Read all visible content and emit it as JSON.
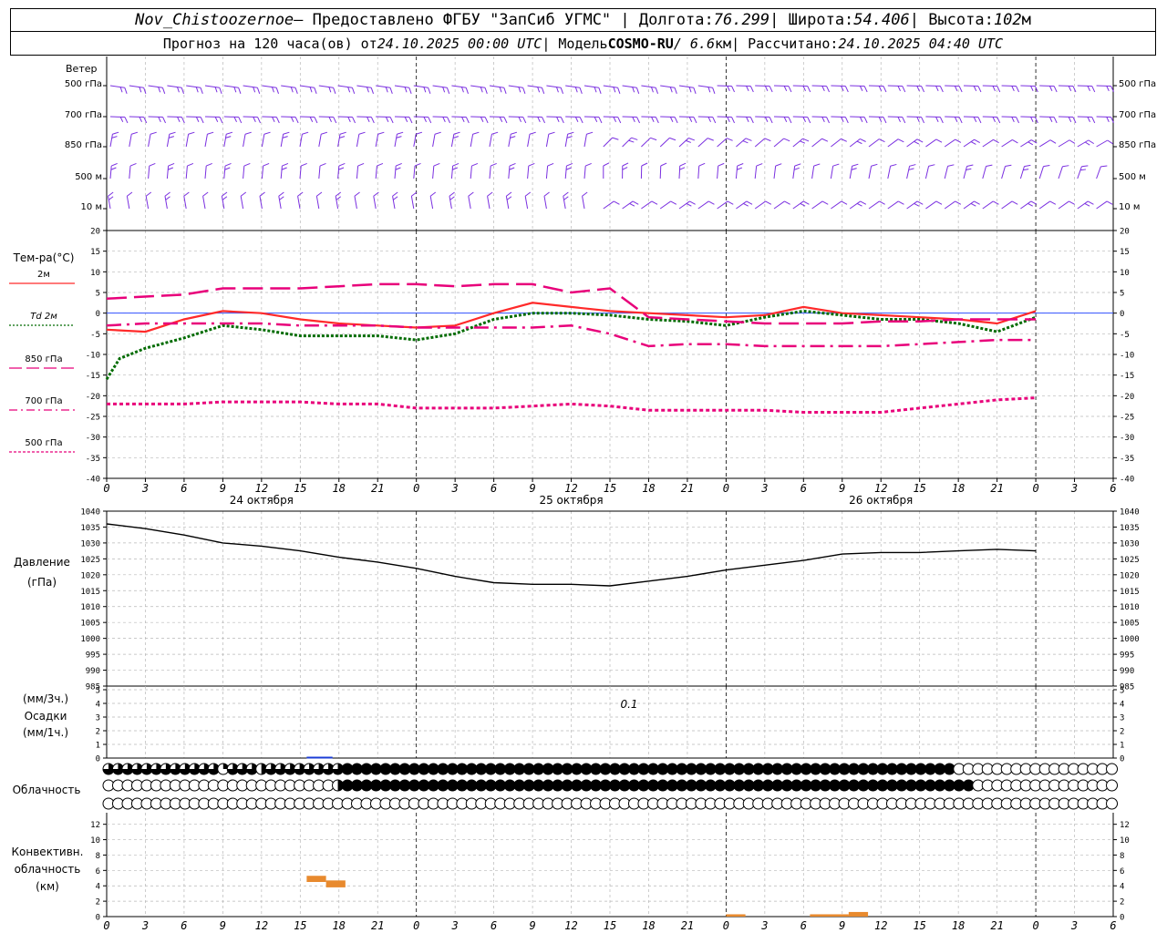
{
  "header": {
    "station": "Nov_Chistoozernoe",
    "provided_by": " – Предоставлено ФГБУ \"ЗапСиб УГМС\" | Долгота: ",
    "longitude": "76.299",
    "lat_label": " | Широта: ",
    "latitude": "54.406",
    "alt_label": " | Высота: ",
    "altitude": "102",
    "alt_unit": "м",
    "forecast_prefix": "Прогноз на 120 часа(ов) от ",
    "forecast_start": "24.10.2025 00:00 UTC",
    "model_label": "  | Модель ",
    "model": "COSMO-RU",
    "resolution": " / 6.6",
    "res_unit": "км",
    "computed_label": " | Рассчитано: ",
    "computed": "24.10.2025 04:40 UTC"
  },
  "wind_panel": {
    "title": "Ветер",
    "levels": [
      "500 гПа",
      "700 гПа",
      "850 гПа",
      "500 м",
      "10  м"
    ]
  },
  "temp_panel": {
    "title": "Тем-ра(°C)",
    "legend": [
      {
        "label": "2м",
        "color": "#ff2a2a",
        "style": "solid"
      },
      {
        "label": "Td  2м",
        "color": "#006b00",
        "style": "dotted"
      },
      {
        "label": "850 гПа",
        "color": "#e8007a",
        "style": "long-dash"
      },
      {
        "label": "700 гПа",
        "color": "#e8007a",
        "style": "dash-dot"
      },
      {
        "label": "500 гПа",
        "color": "#e8007a",
        "style": "short-dash"
      }
    ]
  },
  "pressure_panel": {
    "title": "Давление",
    "unit": "(гПа)"
  },
  "precip_panel": {
    "unit_top": "(мм/3ч.)",
    "title": "Осадки",
    "unit_bottom": "(мм/1ч.)",
    "annotation": "0.1"
  },
  "cloud_panel": {
    "title": "Облачность"
  },
  "conv_panel": {
    "title_1": "Конвективн.",
    "title_2": "облачность",
    "unit": "(км)"
  },
  "x_axis": {
    "hour_ticks": [
      "0",
      "3",
      "6",
      "9",
      "12",
      "15",
      "18",
      "21",
      "0",
      "3",
      "6",
      "9",
      "12",
      "15",
      "18",
      "21",
      "0",
      "3",
      "6",
      "9",
      "12",
      "15",
      "18",
      "21",
      "0",
      "3",
      "6"
    ],
    "days": [
      "24 октября",
      "25 октября",
      "26 октября"
    ]
  },
  "chart_data": [
    {
      "type": "line",
      "panel": "temperature",
      "x_unit": "hours since 24.10.2025 00 UTC",
      "ylim": [
        -40,
        20
      ],
      "yticks": [
        "20",
        "15",
        "10",
        "5",
        "0",
        "-5",
        "-10",
        "-15",
        "-20",
        "-25",
        "-30",
        "-35",
        "-40"
      ],
      "series": [
        {
          "name": "2м",
          "color": "#ff2a2a",
          "x": [
            0,
            3,
            6,
            9,
            12,
            15,
            18,
            21,
            24,
            27,
            30,
            33,
            36,
            39,
            42,
            45,
            48,
            51,
            54,
            57,
            60,
            63,
            66,
            69,
            72
          ],
          "y": [
            -4,
            -4.5,
            -1.5,
            0.5,
            0,
            -1.5,
            -2.5,
            -3,
            -3.5,
            -3,
            0,
            2.5,
            1.5,
            0.5,
            0,
            -0.5,
            -1,
            -0.5,
            1.5,
            0,
            -0.5,
            -1,
            -1.5,
            -2.5,
            0.5
          ]
        },
        {
          "name": "Td  2м",
          "color": "#006b00",
          "x": [
            0,
            1,
            3,
            6,
            9,
            12,
            15,
            18,
            21,
            24,
            27,
            30,
            33,
            36,
            39,
            42,
            45,
            48,
            51,
            54,
            57,
            60,
            63,
            66,
            69,
            72
          ],
          "y": [
            -16,
            -11,
            -8.5,
            -6,
            -3,
            -4,
            -5.5,
            -5.5,
            -5.5,
            -6.5,
            -5,
            -1.5,
            0,
            0,
            -0.5,
            -1.5,
            -2,
            -3,
            -1,
            0.5,
            -0.5,
            -1.5,
            -1.5,
            -2.5,
            -4.5,
            -1
          ]
        },
        {
          "name": "850 гПа",
          "color": "#e8007a",
          "x": [
            0,
            3,
            6,
            9,
            12,
            15,
            18,
            21,
            24,
            27,
            30,
            33,
            36,
            39,
            42,
            45,
            48,
            51,
            54,
            57,
            60,
            63,
            66,
            69,
            72
          ],
          "y": [
            3.5,
            4,
            4.5,
            6,
            6,
            6,
            6.5,
            7,
            7,
            6.5,
            7,
            7,
            5,
            6,
            -1,
            -1.5,
            -2,
            -2.5,
            -2.5,
            -2.5,
            -2,
            -2,
            -1.5,
            -1.5,
            -1.5
          ]
        },
        {
          "name": "700 гПа",
          "color": "#e8007a",
          "x": [
            0,
            3,
            6,
            9,
            12,
            15,
            18,
            21,
            24,
            27,
            30,
            33,
            36,
            39,
            42,
            45,
            48,
            51,
            54,
            57,
            60,
            63,
            66,
            69,
            72
          ],
          "y": [
            -3,
            -2.5,
            -2.5,
            -2.5,
            -2.5,
            -3,
            -3,
            -3,
            -3.5,
            -3.5,
            -3.5,
            -3.5,
            -3,
            -5,
            -8,
            -7.5,
            -7.5,
            -8,
            -8,
            -8,
            -8,
            -7.5,
            -7,
            -6.5,
            -6.5
          ]
        },
        {
          "name": "500 гПа",
          "color": "#e8007a",
          "x": [
            0,
            3,
            6,
            9,
            12,
            15,
            18,
            21,
            24,
            27,
            30,
            33,
            36,
            39,
            42,
            45,
            48,
            51,
            54,
            57,
            60,
            63,
            66,
            69,
            72
          ],
          "y": [
            -22,
            -22,
            -22,
            -21.5,
            -21.5,
            -21.5,
            -22,
            -22,
            -23,
            -23,
            -23,
            -22.5,
            -22,
            -22.5,
            -23.5,
            -23.5,
            -23.5,
            -23.5,
            -24,
            -24,
            -24,
            -23,
            -22,
            -21,
            -20.5
          ]
        }
      ]
    },
    {
      "type": "line",
      "panel": "pressure",
      "x_unit": "hours since 24.10.2025 00 UTC",
      "ylim": [
        985,
        1040
      ],
      "yticks": [
        "1040",
        "1035",
        "1030",
        "1025",
        "1020",
        "1015",
        "1010",
        "1005",
        "1000",
        "995",
        "990",
        "985"
      ],
      "series": [
        {
          "color": "#000000",
          "x": [
            0,
            3,
            6,
            9,
            12,
            15,
            18,
            21,
            24,
            27,
            30,
            33,
            36,
            39,
            42,
            45,
            48,
            51,
            54,
            57,
            60,
            63,
            66,
            69,
            72
          ],
          "y": [
            1036,
            1034.5,
            1032.5,
            1030,
            1029,
            1027.5,
            1025.5,
            1024,
            1022,
            1019.5,
            1017.5,
            1017,
            1017,
            1016.5,
            1018,
            1019.5,
            1021.5,
            1023,
            1024.5,
            1026.5,
            1027,
            1027,
            1027.5,
            1028,
            1027.5
          ]
        }
      ]
    },
    {
      "type": "bar",
      "panel": "precipitation",
      "ylim": [
        0,
        5
      ],
      "yticks": [
        "5",
        "4",
        "3",
        "2",
        "1",
        "0"
      ],
      "series": [
        {
          "color": "#1a3cd6",
          "x": [
            16.5
          ],
          "y": [
            0.1
          ]
        }
      ]
    },
    {
      "type": "bar",
      "panel": "convective_cloud",
      "ylim": [
        0,
        12
      ],
      "yticks": [
        "12",
        "10",
        "8",
        "6",
        "4",
        "2",
        "0"
      ],
      "series": [
        {
          "color": "#e88a2e",
          "segments": [
            {
              "x_from": 15.5,
              "x_to": 17,
              "base": 4.5,
              "top": 5.3
            },
            {
              "x_from": 17,
              "x_to": 18.5,
              "base": 3.8,
              "top": 4.7
            },
            {
              "x_from": 48,
              "x_to": 49.5,
              "base": 0,
              "top": 0.3
            },
            {
              "x_from": 54.5,
              "x_to": 57.5,
              "base": 0,
              "top": 0.3
            },
            {
              "x_from": 57.5,
              "x_to": 59,
              "base": 0,
              "top": 0.6
            }
          ]
        }
      ]
    },
    {
      "type": "heatmap",
      "panel": "cloudiness",
      "rows": [
        "upper",
        "middle",
        "lower"
      ],
      "symbols": {
        "upper": "pfffffffffffqfffhfffffffpFFFFFFFFFFFFFFFFFFFFFFFFFFFFFFFFFFFFFFFFFFFFFFFFFFFFFFFFFFFFFFFF",
        "middle": "oooooooooooooooooooooooohFFFFFFFFFFFFFFFFFFFFFFFFFFFFFFFFFFFFFFFFFFFFFFFFFFFFFFFFFFFFFFFFFF",
        "lower": "ooooooooooooooooooooooooooooooooooooooooooooooooooooooooooooooooooooooooooooooooooooooooooooooooooooooooooo"
      },
      "legend": {
        "o": "clear",
        "q": "quarter",
        "h": "half",
        "t": "three-quarter",
        "F": "overcast",
        "p": "partial"
      }
    }
  ]
}
